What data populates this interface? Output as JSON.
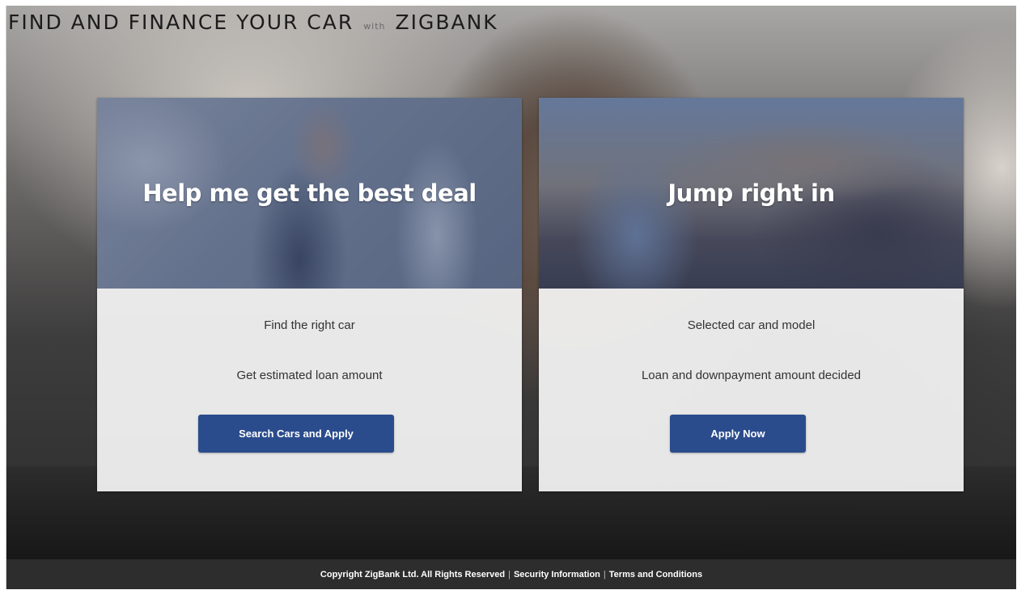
{
  "header": {
    "title_main": "FIND AND FINANCE YOUR CAR",
    "title_with": "with",
    "title_brand": "ZIGBANK"
  },
  "cards": [
    {
      "heading": "Help me get the best deal",
      "features": [
        "Find the right car",
        "Get estimated loan amount"
      ],
      "button_label": "Search Cars and Apply"
    },
    {
      "heading": "Jump right in",
      "features": [
        "Selected car and model",
        "Loan and downpayment amount decided"
      ],
      "button_label": "Apply Now"
    }
  ],
  "footer": {
    "copyright": "Copyright ZigBank Ltd. All Rights Reserved",
    "separator": "|",
    "security_link": "Security Information",
    "terms_link": "Terms and Conditions"
  },
  "colors": {
    "button": "#2b4c8c",
    "footer": "#2d2d2d",
    "hero_tint": "#374870"
  }
}
